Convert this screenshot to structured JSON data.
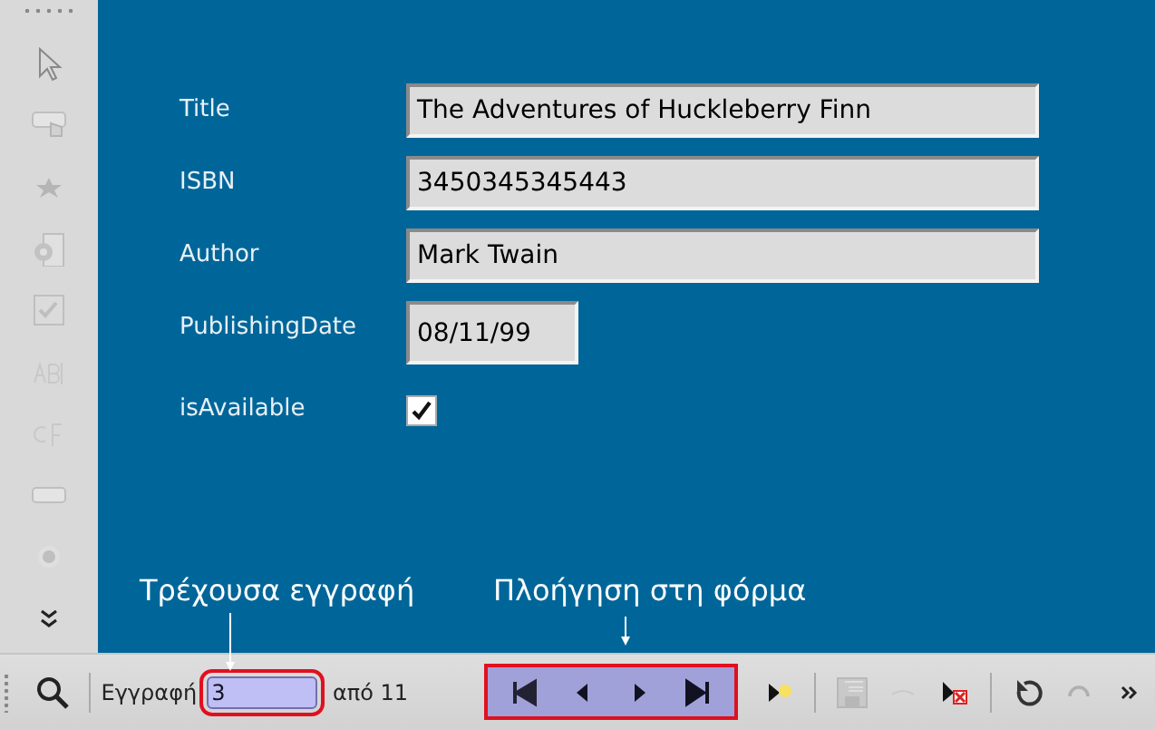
{
  "side_toolbar": {
    "tools": [
      {
        "kind": "pointer",
        "disabled": false
      },
      {
        "kind": "push-button",
        "disabled": true
      },
      {
        "kind": "star",
        "disabled": true
      },
      {
        "kind": "settings-page",
        "disabled": true
      },
      {
        "kind": "checkbox",
        "disabled": true
      },
      {
        "kind": "text-field",
        "disabled": true
      },
      {
        "kind": "formatted-field",
        "disabled": true
      },
      {
        "kind": "small-button",
        "disabled": true
      },
      {
        "kind": "radio",
        "disabled": true
      },
      {
        "kind": "more",
        "disabled": false
      }
    ]
  },
  "form": {
    "fields": [
      {
        "label": "Title",
        "kind": "text",
        "value": "The Adventures of Huckleberry Finn"
      },
      {
        "label": "ISBN",
        "kind": "text",
        "value": "3450345345443"
      },
      {
        "label": "Author",
        "kind": "text",
        "value": "Mark Twain"
      },
      {
        "label": "PublishingDate",
        "kind": "date",
        "value": "08/11/99"
      },
      {
        "label": "isAvailable",
        "kind": "checkbox",
        "checked": true
      }
    ]
  },
  "annotations": [
    {
      "text": "Τρέχουσα εγγραφή"
    },
    {
      "text": "Πλοήγηση στη φόρμα"
    }
  ],
  "navigation_bar": {
    "record_label": "Εγγραφή",
    "record_field": {
      "value": "3",
      "highlighted": true
    },
    "total": "από 11",
    "navigation": {
      "highlighted": true,
      "buttons": [
        {
          "kind": "first"
        },
        {
          "kind": "previous"
        },
        {
          "kind": "next"
        },
        {
          "kind": "last"
        }
      ]
    },
    "actions": [
      {
        "kind": "new",
        "disabled": false
      },
      {
        "kind": "separator"
      },
      {
        "kind": "save",
        "disabled": true
      },
      {
        "kind": "undo",
        "disabled": true
      },
      {
        "kind": "delete",
        "disabled": false
      },
      {
        "kind": "separator"
      },
      {
        "kind": "refresh",
        "disabled": false
      },
      {
        "kind": "redo",
        "disabled": true
      },
      {
        "kind": "more",
        "disabled": false
      }
    ]
  }
}
